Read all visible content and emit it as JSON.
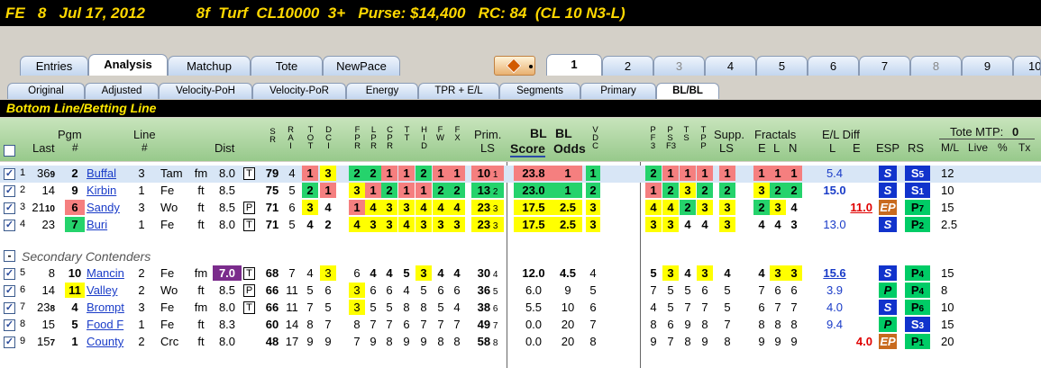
{
  "header": {
    "race": "FE   8   Jul 17, 2012",
    "details": "8f  Turf  CL10000  3+   Purse: $14,400   RC: 84  (CL 10 N3-L)"
  },
  "tabs": [
    "Entries",
    "Analysis",
    "Matchup",
    "Tote",
    "NewPace"
  ],
  "race_tabs": [
    "1",
    "2",
    "3",
    "4",
    "5",
    "6",
    "7",
    "8",
    "9",
    "10"
  ],
  "subtabs": [
    "Original",
    "Adjusted",
    "Velocity-PoH",
    "Velocity-PoR",
    "Energy",
    "TPR + E/L",
    "Segments",
    "Primary",
    "BL/BL"
  ],
  "section_title": "Bottom Line/Betting Line",
  "columns": {
    "last": "Last",
    "pgm": "Pgm",
    "pgm2": "#",
    "line": "Line",
    "line2": "#",
    "dist": "Dist",
    "prim": "Prim.",
    "ls": "LS",
    "bl1": "BL",
    "bl2": "BL",
    "score": "Score",
    "odds": "Odds",
    "supp": "Supp.",
    "fractals": "Fractals",
    "e": "E",
    "l": "L",
    "n": "N",
    "eldiff": "E/L Diff",
    "eld_l": "L",
    "eld_e": "E",
    "esp": "ESP",
    "rs": "RS",
    "tote_mtp": "Tote MTP:",
    "mtp_val": "0",
    "ml": "M/L",
    "live": "Live",
    "pct": "%",
    "tx": "Tx"
  },
  "secondary_label": "Secondary Contenders",
  "rows": [
    {
      "n": "1",
      "last": "36",
      "lastsup": "9",
      "pgm": "2",
      "line": "3",
      "name": "Buffal",
      "trk": "Tam",
      "surf": "fm",
      "dist": "8.0",
      "dflag": "T",
      "sr": "79",
      "ra": "4",
      "a": [
        "1",
        "3"
      ],
      "f": [
        "2",
        "2",
        "1",
        "1",
        "2",
        "1",
        "1"
      ],
      "prim": "10",
      "primsup": "1",
      "score": "23.8",
      "odds": "1",
      "vdc": "1",
      "p": [
        "2",
        "1",
        "1",
        "1"
      ],
      "supp": "1",
      "fr": [
        "1",
        "1",
        "1"
      ],
      "eld": "5.4",
      "ele": "",
      "esp": "S",
      "rs": "S",
      "rssup": "5",
      "ml": "12"
    },
    {
      "n": "2",
      "last": "14",
      "lastsup": "",
      "pgm": "9",
      "line": "1",
      "name": "Kirbin",
      "trk": "Fe",
      "surf": "ft",
      "dist": "8.5",
      "dflag": "",
      "sr": "75",
      "ra": "5",
      "a": [
        "2",
        "1"
      ],
      "f": [
        "3",
        "1",
        "2",
        "1",
        "1",
        "2",
        "2"
      ],
      "prim": "13",
      "primsup": "2",
      "score": "23.0",
      "odds": "1",
      "vdc": "2",
      "p": [
        "1",
        "2",
        "3",
        "2"
      ],
      "supp": "2",
      "fr": [
        "3",
        "2",
        "2"
      ],
      "eld": "15.0",
      "ele": "",
      "esp": "S",
      "rs": "S",
      "rssup": "1",
      "ml": "10"
    },
    {
      "n": "3",
      "last": "21",
      "lastsup": "10",
      "pgm": "6",
      "line": "3",
      "name": "Sandy",
      "trk": "Wo",
      "surf": "ft",
      "dist": "8.5",
      "dflag": "P",
      "sr": "71",
      "ra": "6",
      "a": [
        "3",
        "4"
      ],
      "f": [
        "1",
        "4",
        "3",
        "3",
        "4",
        "4",
        "4"
      ],
      "prim": "23",
      "primsup": "3",
      "score": "17.5",
      "odds": "2.5",
      "vdc": "3",
      "p": [
        "4",
        "4",
        "2",
        "3"
      ],
      "supp": "3",
      "fr": [
        "2",
        "3",
        "4"
      ],
      "eld": "",
      "ele": "11.0",
      "esp": "EP",
      "rs": "P",
      "rssup": "7",
      "ml": "15"
    },
    {
      "n": "4",
      "last": "23",
      "lastsup": "",
      "pgm": "7",
      "line": "1",
      "name": "Buri",
      "trk": "Fe",
      "surf": "ft",
      "dist": "8.0",
      "dflag": "T",
      "sr": "71",
      "ra": "5",
      "a": [
        "4",
        "2"
      ],
      "f": [
        "4",
        "3",
        "3",
        "4",
        "3",
        "3",
        "3"
      ],
      "prim": "23",
      "primsup": "3",
      "score": "17.5",
      "odds": "2.5",
      "vdc": "3",
      "p": [
        "3",
        "3",
        "4",
        "4"
      ],
      "supp": "3",
      "fr": [
        "4",
        "4",
        "3"
      ],
      "eld": "13.0",
      "ele": "",
      "esp": "S",
      "rs": "P",
      "rssup": "2",
      "ml": "2.5"
    },
    {
      "n": "5",
      "last": "8",
      "lastsup": "",
      "pgm": "10",
      "line": "2",
      "name": "Mancin",
      "trk": "Fe",
      "surf": "fm",
      "dist": "7.0",
      "dflag": "T",
      "sr": "68",
      "ra": "7",
      "a": [
        "4",
        "3"
      ],
      "f": [
        "6",
        "4",
        "4",
        "5",
        "3",
        "4",
        "4"
      ],
      "prim": "30",
      "primsup": "4",
      "score": "12.0",
      "odds": "4.5",
      "vdc": "4",
      "p": [
        "5",
        "3",
        "4",
        "3"
      ],
      "supp": "4",
      "fr": [
        "4",
        "3",
        "3"
      ],
      "eld": "15.6",
      "ele": "",
      "esp": "S",
      "rs": "P",
      "rssup": "4",
      "ml": "15"
    },
    {
      "n": "6",
      "last": "14",
      "lastsup": "",
      "pgm": "11",
      "line": "2",
      "name": "Valley",
      "trk": "Wo",
      "surf": "ft",
      "dist": "8.5",
      "dflag": "P",
      "sr": "66",
      "ra": "11",
      "a": [
        "5",
        "6"
      ],
      "f": [
        "3",
        "6",
        "6",
        "4",
        "5",
        "6",
        "6"
      ],
      "prim": "36",
      "primsup": "5",
      "score": "6.0",
      "odds": "9",
      "vdc": "5",
      "p": [
        "7",
        "5",
        "5",
        "6"
      ],
      "supp": "5",
      "fr": [
        "7",
        "6",
        "6"
      ],
      "eld": "3.9",
      "ele": "",
      "esp": "P",
      "rs": "P",
      "rssup": "4",
      "ml": "8"
    },
    {
      "n": "7",
      "last": "23",
      "lastsup": "8",
      "pgm": "4",
      "line": "3",
      "name": "Brompt",
      "trk": "Fe",
      "surf": "fm",
      "dist": "8.0",
      "dflag": "T",
      "sr": "66",
      "ra": "11",
      "a": [
        "7",
        "5"
      ],
      "f": [
        "3",
        "5",
        "5",
        "8",
        "8",
        "5",
        "4"
      ],
      "prim": "38",
      "primsup": "6",
      "score": "5.5",
      "odds": "10",
      "vdc": "6",
      "p": [
        "4",
        "5",
        "7",
        "7"
      ],
      "supp": "5",
      "fr": [
        "6",
        "7",
        "7"
      ],
      "eld": "4.0",
      "ele": "",
      "esp": "S",
      "rs": "P",
      "rssup": "6",
      "ml": "10"
    },
    {
      "n": "8",
      "last": "15",
      "lastsup": "",
      "pgm": "5",
      "line": "1",
      "name": "Food F",
      "trk": "Fe",
      "surf": "ft",
      "dist": "8.3",
      "dflag": "",
      "sr": "60",
      "ra": "14",
      "a": [
        "8",
        "7"
      ],
      "f": [
        "8",
        "7",
        "7",
        "6",
        "7",
        "7",
        "7"
      ],
      "prim": "49",
      "primsup": "7",
      "score": "0.0",
      "odds": "20",
      "vdc": "7",
      "p": [
        "8",
        "6",
        "9",
        "8"
      ],
      "supp": "7",
      "fr": [
        "8",
        "8",
        "8"
      ],
      "eld": "9.4",
      "ele": "",
      "esp": "P",
      "rs": "S",
      "rssup": "3",
      "ml": "15"
    },
    {
      "n": "9",
      "last": "15",
      "lastsup": "7",
      "pgm": "1",
      "line": "2",
      "name": "County",
      "trk": "Crc",
      "surf": "ft",
      "dist": "8.0",
      "dflag": "",
      "sr": "48",
      "ra": "17",
      "a": [
        "9",
        "9"
      ],
      "f": [
        "7",
        "9",
        "8",
        "9",
        "9",
        "8",
        "8"
      ],
      "prim": "58",
      "primsup": "8",
      "score": "0.0",
      "odds": "20",
      "vdc": "8",
      "p": [
        "9",
        "7",
        "8",
        "9"
      ],
      "supp": "8",
      "fr": [
        "9",
        "9",
        "9"
      ],
      "eld": "",
      "ele": "4.0",
      "esp": "EP",
      "rs": "P",
      "rssup": "1",
      "ml": "20"
    }
  ]
}
